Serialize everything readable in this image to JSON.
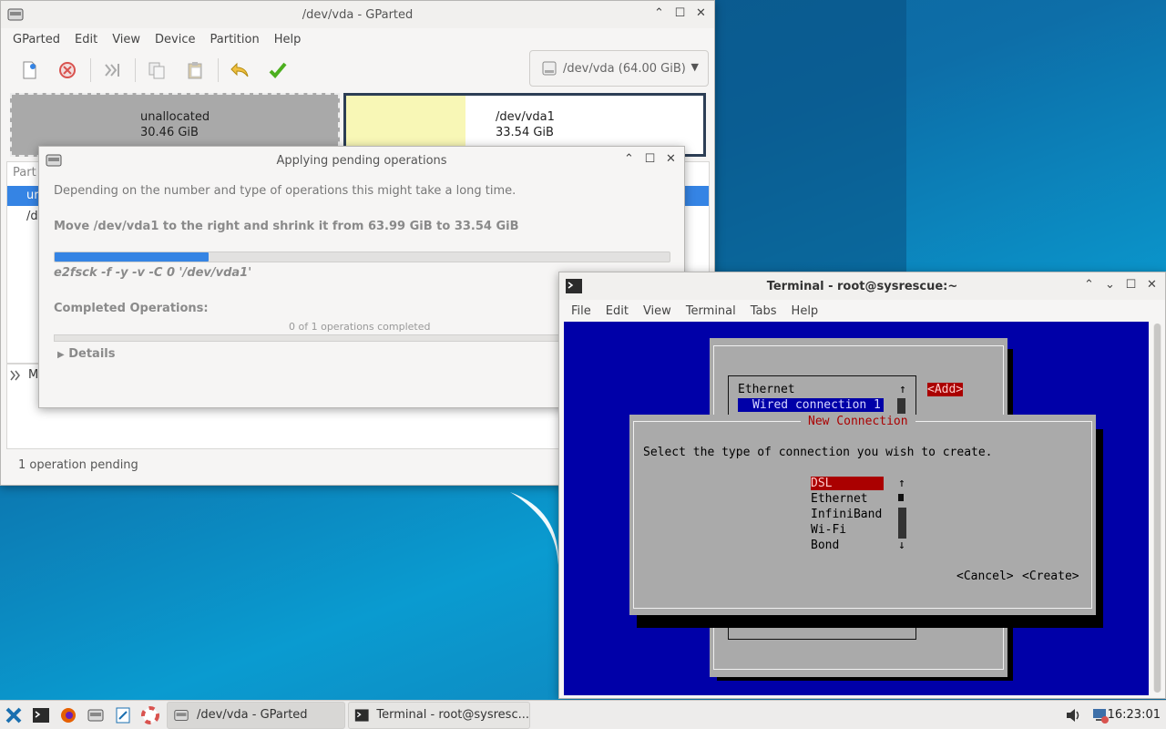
{
  "gparted": {
    "title": "/dev/vda - GParted",
    "menu": [
      "GParted",
      "Edit",
      "View",
      "Device",
      "Partition",
      "Help"
    ],
    "device_select": "/dev/vda  (64.00 GiB)",
    "unallocated": {
      "label": "unallocated",
      "size": "30.46 GiB"
    },
    "vda1": {
      "label": "/dev/vda1",
      "size": "33.54 GiB"
    },
    "rows_partial": [
      "Part",
      "ur",
      "/de",
      "M"
    ],
    "status": "1 operation pending"
  },
  "apply_dialog": {
    "title": "Applying pending operations",
    "intro": "Depending on the number and type of operations this might take a long time.",
    "operation": "Move /dev/vda1 to the right and shrink it from 63.99 GiB to 33.54 GiB",
    "progress": 0.25,
    "command": "e2fsck -f -y -v -C 0 '/dev/vda1'",
    "completed_heading": "Completed Operations:",
    "completed_count": "0 of 1 operations completed",
    "details_label": "Details"
  },
  "terminal": {
    "title": "Terminal - root@sysrescue:~",
    "menu": [
      "File",
      "Edit",
      "View",
      "Terminal",
      "Tabs",
      "Help"
    ],
    "bg_list": {
      "header": "Ethernet",
      "item": "Wired connection 1",
      "add": "<Add>"
    },
    "dialog": {
      "title": "New Connection",
      "prompt": "Select the type of connection you wish to create.",
      "options": [
        "DSL",
        "Ethernet",
        "InfiniBand",
        "Wi-Fi",
        "Bond"
      ],
      "selected": "DSL",
      "cancel": "<Cancel>",
      "create": "<Create>"
    }
  },
  "taskbar": {
    "tasks": [
      "/dev/vda - GParted",
      "Terminal - root@sysresc..."
    ],
    "clock": "16:23:01"
  }
}
